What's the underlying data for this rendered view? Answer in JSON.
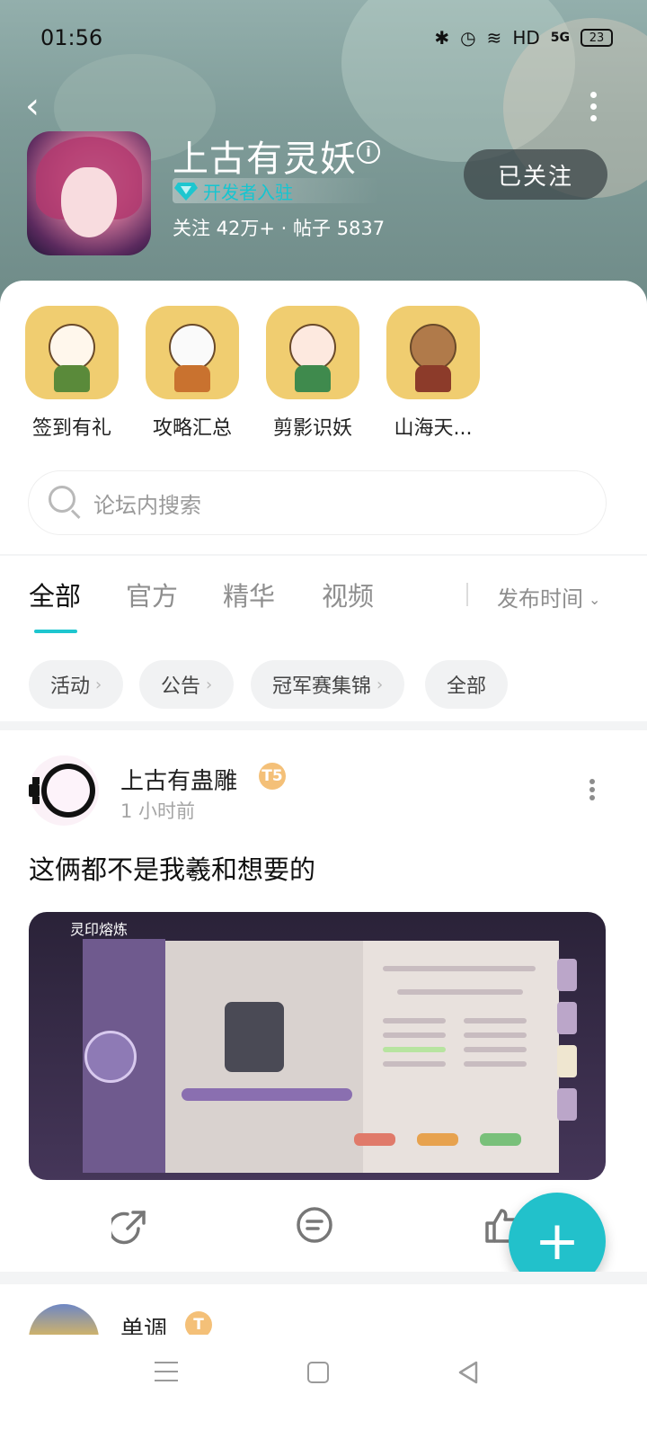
{
  "status_bar": {
    "time": "01:56",
    "network": "HD",
    "signal": "5G",
    "battery": "23"
  },
  "header": {
    "game_title": "上古有灵妖",
    "developer_badge": "开发者入驻",
    "meta": "关注 42万+ · 帖子 5837",
    "follow_button": "已关注"
  },
  "quick_links": [
    {
      "label": "签到有礼",
      "color": "#5a8a3a"
    },
    {
      "label": "攻略汇总",
      "color": "#c9722f"
    },
    {
      "label": "剪影识妖",
      "color": "#3f8a4d"
    },
    {
      "label": "山海天..."
    }
  ],
  "search": {
    "placeholder": "论坛内搜索"
  },
  "tabs": [
    "全部",
    "官方",
    "精华",
    "视频"
  ],
  "sort": {
    "label": "发布时间"
  },
  "chips": [
    "活动",
    "公告",
    "冠军赛集锦",
    "全部"
  ],
  "post": {
    "author": "上古有蛊雕",
    "level": "T5",
    "time": "1 小时前",
    "title": "这俩都不是我羲和想要的",
    "image_caption": "灵印熔炼"
  },
  "post2": {
    "author": "单调",
    "level": "T"
  },
  "colors": {
    "accent": "#22c1cb",
    "developer_badge": "#15c5d0",
    "level_badge": "#f4c078"
  }
}
